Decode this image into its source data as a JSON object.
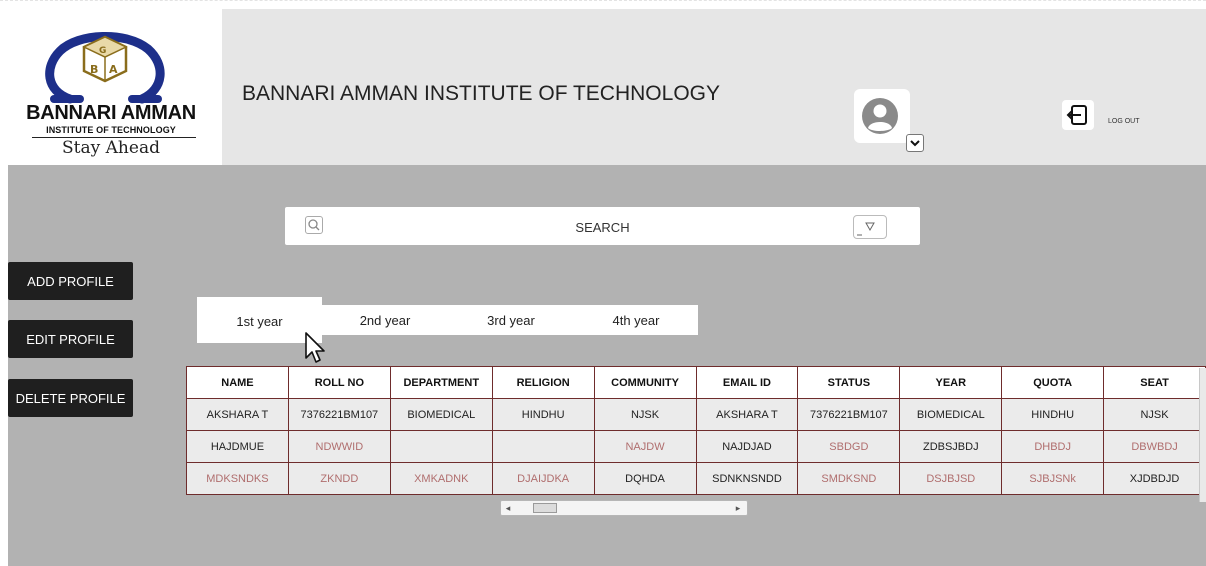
{
  "logo": {
    "name": "BANNARI AMMAN",
    "subtitle": "INSTITUTE OF TECHNOLOGY",
    "tagline": "Stay Ahead"
  },
  "header": {
    "title": "BANNARI AMMAN INSTITUTE OF TECHNOLOGY",
    "logout_label": "LOG OUT"
  },
  "search": {
    "label": "SEARCH"
  },
  "sidebar": {
    "buttons": [
      {
        "label": "ADD PROFILE"
      },
      {
        "label": "EDIT PROFILE"
      },
      {
        "label": "DELETE PROFILE"
      }
    ]
  },
  "tabs": [
    {
      "label": "1st year",
      "active": true
    },
    {
      "label": "2nd year"
    },
    {
      "label": "3rd year"
    },
    {
      "label": "4th year"
    }
  ],
  "table": {
    "columns": [
      "NAME",
      "ROLL NO",
      "DEPARTMENT",
      "RELIGION",
      "COMMUNITY",
      "EMAIL ID",
      "STATUS",
      "YEAR",
      "QUOTA",
      "SEAT"
    ],
    "rows": [
      [
        "AKSHARA T",
        "7376221BM107",
        "BIOMEDICAL",
        "HINDHU",
        "NJSK",
        "AKSHARA T",
        "7376221BM107",
        "BIOMEDICAL",
        "HINDHU",
        "NJSK"
      ],
      [
        "HAJDMUE",
        "NDWWID",
        "",
        "",
        "NAJDW",
        "NAJDJAD",
        "SBDGD",
        "ZDBSJBDJ",
        "DHBDJ",
        "DBWBDJ"
      ],
      [
        "MDKSNDKS",
        "ZKNDD",
        "XMKADNK",
        "DJAIJDKA",
        "DQHDA",
        "SDNKNSNDD",
        "SMDKSND",
        "DSJBJSD",
        "SJBJSNk",
        "XJDBDJD"
      ]
    ]
  },
  "colors": {
    "header_bg": "#e6e6e6",
    "main_bg": "#b2b2b2",
    "button_bg": "#1f1f1f",
    "table_border": "#6e2c2c",
    "logo_blue": "#1d2f8a",
    "faded_text": "#b06e6e"
  },
  "icons": [
    "logo-emblem-icon",
    "avatar-icon",
    "chevron-down-icon",
    "logout-icon",
    "search-icon",
    "filter-icon",
    "cursor-icon"
  ]
}
